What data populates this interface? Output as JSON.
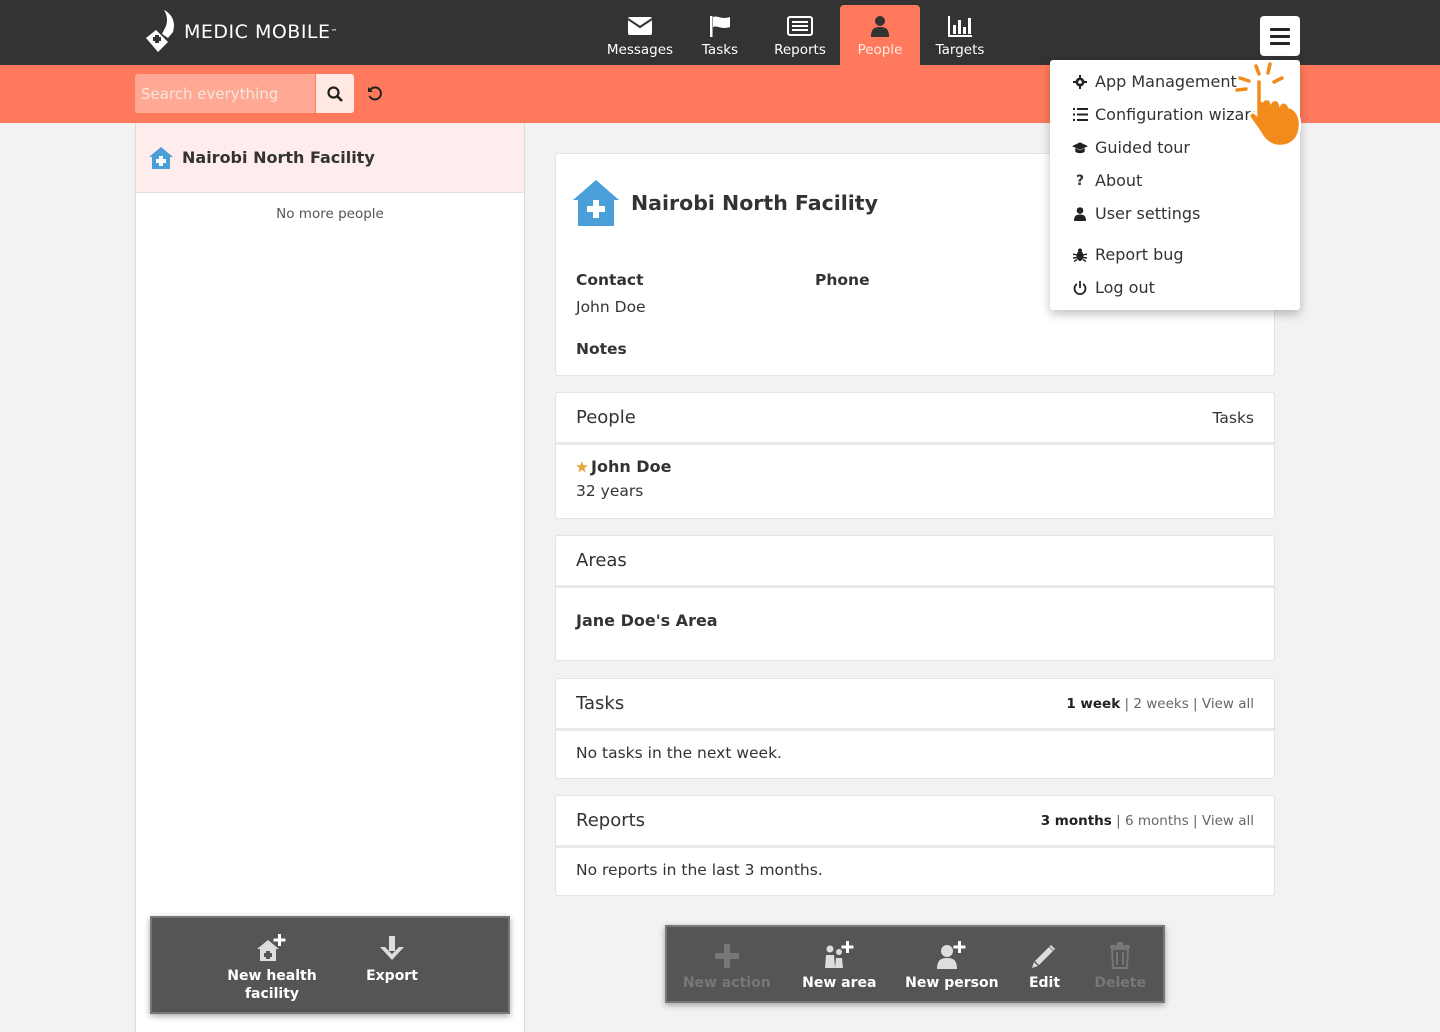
{
  "header": {
    "brand": "MEDIC MOBILE",
    "brand_tm": "™",
    "tabs": [
      {
        "label": "Messages",
        "icon": "envelope-icon"
      },
      {
        "label": "Tasks",
        "icon": "flag-icon"
      },
      {
        "label": "Reports",
        "icon": "list-icon"
      },
      {
        "label": "People",
        "icon": "person-icon",
        "active": true
      },
      {
        "label": "Targets",
        "icon": "bar-chart-icon"
      }
    ]
  },
  "search": {
    "placeholder": "Search everything"
  },
  "list": {
    "items": [
      {
        "label": "Nairobi North Facility",
        "icon": "health-facility-icon"
      }
    ],
    "footer": "No more people"
  },
  "facility": {
    "title": "Nairobi North Facility",
    "contact_label": "Contact",
    "contact_value": "John Doe",
    "phone_label": "Phone",
    "notes_label": "Notes"
  },
  "people_section": {
    "title": "People",
    "right_link": "Tasks",
    "person_name": "John Doe",
    "person_age": "32 years"
  },
  "areas_section": {
    "title": "Areas",
    "area_name": "Jane Doe's Area"
  },
  "tasks_section": {
    "title": "Tasks",
    "filter_active": "1 week",
    "filter_2": "2 weeks",
    "filter_3": "View all",
    "sep": "|",
    "empty": "No tasks in the next week."
  },
  "reports_section": {
    "title": "Reports",
    "filter_active": "3 months",
    "filter_2": "6 months",
    "filter_3": "View all",
    "sep": "|",
    "empty": "No reports in the last 3 months."
  },
  "left_actions": {
    "new_facility_line1": "New health",
    "new_facility_line2": "facility",
    "export": "Export"
  },
  "right_actions": {
    "new_action": "New action",
    "new_area": "New area",
    "new_person": "New person",
    "edit": "Edit",
    "delete": "Delete"
  },
  "menu": {
    "app_management": "App Management",
    "config_wizard": "Configuration wizard",
    "guided_tour": "Guided tour",
    "about": "About",
    "user_settings": "User settings",
    "report_bug": "Report bug",
    "log_out": "Log out"
  },
  "colors": {
    "header_bg": "#333333",
    "accent": "#ff7a5c",
    "facility_icon": "#4a9fd8",
    "star": "#e8a53a",
    "hand": "#f28a1c"
  }
}
